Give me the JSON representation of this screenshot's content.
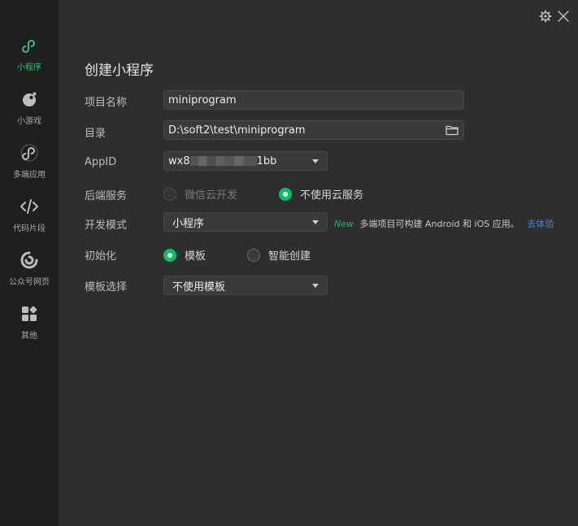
{
  "sidebar": {
    "items": [
      {
        "label": "小程序",
        "icon": "miniprogram-icon",
        "active": true
      },
      {
        "label": "小游戏",
        "icon": "minigame-icon",
        "active": false
      },
      {
        "label": "多端应用",
        "icon": "multiplatform-app-icon",
        "active": false
      },
      {
        "label": "代码片段",
        "icon": "code-snippet-icon",
        "active": false
      },
      {
        "label": "公众号网页",
        "icon": "official-account-web-icon",
        "active": false
      },
      {
        "label": "其他",
        "icon": "other-apps-icon",
        "active": false
      }
    ]
  },
  "header": {
    "settings_icon": "gear-icon",
    "close_icon": "close-icon"
  },
  "form": {
    "title": "创建小程序",
    "project_name": {
      "label": "项目名称",
      "value": "miniprogram"
    },
    "directory": {
      "label": "目录",
      "value": "D:\\soft2\\test\\miniprogram",
      "icon": "folder-icon"
    },
    "appid": {
      "label": "AppID",
      "value_prefix": "wx8",
      "value_suffix": "1bb"
    },
    "backend": {
      "label": "后端服务",
      "options": [
        {
          "label": "微信云开发",
          "selected": false,
          "disabled": true
        },
        {
          "label": "不使用云服务",
          "selected": true,
          "disabled": false
        }
      ]
    },
    "dev_mode": {
      "label": "开发模式",
      "value": "小程序",
      "tip_new": "New",
      "tip_text": "多端项目可构建 Android 和 iOS 应用。",
      "tip_link": "去体验"
    },
    "init": {
      "label": "初始化",
      "options": [
        {
          "label": "模板",
          "selected": true
        },
        {
          "label": "智能创建",
          "selected": false
        }
      ]
    },
    "template": {
      "label": "模板选择",
      "value": "不使用模板"
    }
  },
  "colors": {
    "accent": "#07c160",
    "sidebar_bg": "#1f1f1f",
    "main_bg": "#2e2e2e",
    "link": "#3d8ee8"
  }
}
